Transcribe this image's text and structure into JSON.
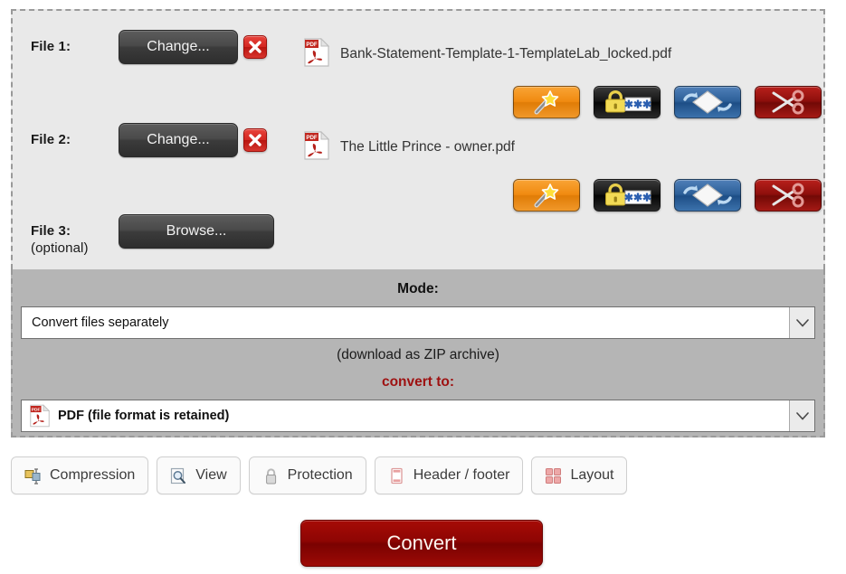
{
  "files": [
    {
      "label": "File 1:",
      "sub": "",
      "button": "Change...",
      "filename": "Bank-Statement-Template-1-TemplateLab_locked.pdf",
      "has_file": true,
      "actions": [
        {
          "name": "enhance-wand",
          "title": "Enhance"
        },
        {
          "name": "password-lock",
          "title": "Password"
        },
        {
          "name": "rotate-pages",
          "title": "Rotate"
        },
        {
          "name": "split-scissors",
          "title": "Split"
        }
      ]
    },
    {
      "label": "File 2:",
      "sub": "",
      "button": "Change...",
      "filename": "The Little Prince - owner.pdf",
      "has_file": true,
      "actions": [
        {
          "name": "enhance-wand",
          "title": "Enhance"
        },
        {
          "name": "password-lock",
          "title": "Password"
        },
        {
          "name": "rotate-pages",
          "title": "Rotate"
        },
        {
          "name": "split-scissors",
          "title": "Split"
        }
      ]
    },
    {
      "label": "File 3:",
      "sub": "(optional)",
      "button": "Browse...",
      "filename": "",
      "has_file": false,
      "actions": []
    }
  ],
  "mode": {
    "title": "Mode:",
    "selected": "Convert files separately",
    "note": "(download as ZIP archive)"
  },
  "convert_to": {
    "title": "convert to:",
    "selected": "PDF (file format is retained)",
    "icon": "pdf-icon"
  },
  "tabs": [
    {
      "label": "Compression",
      "icon": "compression-icon"
    },
    {
      "label": "View",
      "icon": "view-magnifier-icon"
    },
    {
      "label": "Protection",
      "icon": "protection-lock-icon"
    },
    {
      "label": "Header / footer",
      "icon": "header-footer-icon"
    },
    {
      "label": "Layout",
      "icon": "layout-grid-icon"
    }
  ],
  "submit": {
    "label": "Convert"
  },
  "colors": {
    "panel_light": "#e9e9e9",
    "panel_gray": "#b5b5b5",
    "convert_to_text": "#9e1111",
    "submit_red": "#8e0503",
    "delete_red": "#d32620",
    "wand_orange": "#f08a10",
    "rotate_blue": "#2d6099",
    "cut_red": "#8e0f0c"
  }
}
